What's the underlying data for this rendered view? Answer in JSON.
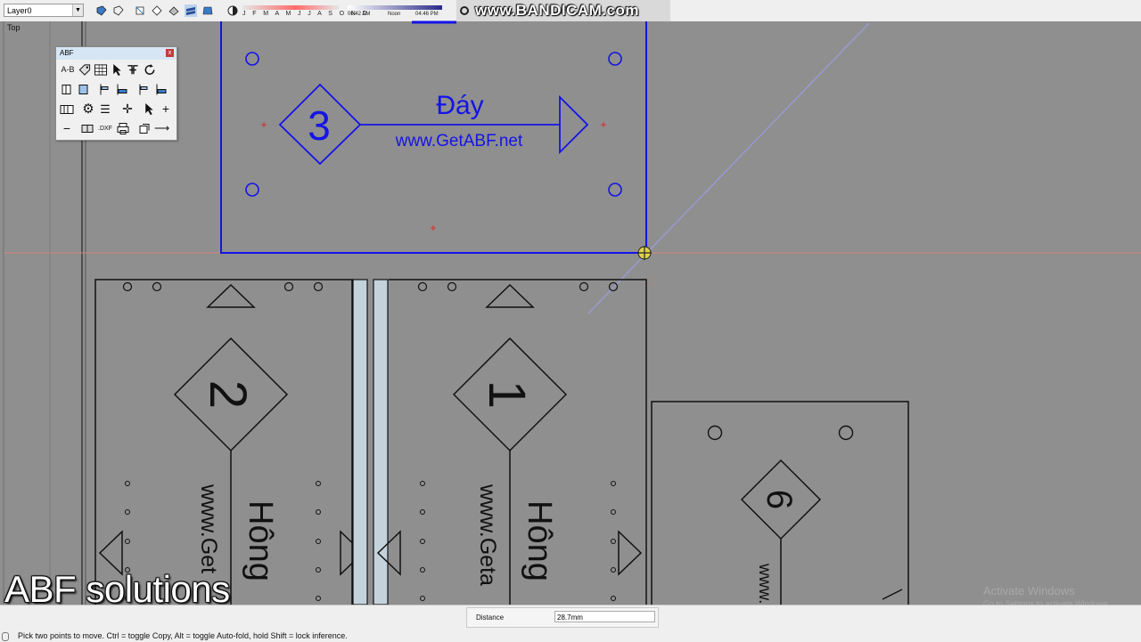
{
  "toolbar": {
    "layer_value": "Layer0",
    "month_labels": "J F M A M J J A S O N D",
    "time_start": "06:42 AM",
    "time_noon": "Noon",
    "time_end": "04:46 PM",
    "tools": [
      "shape-a-icon",
      "shape-b-icon",
      "rect-icon",
      "poly-icon",
      "prism-icon",
      "layers-a-icon",
      "layers-b-icon",
      "shadow-icon",
      "gear-tool-icon"
    ]
  },
  "view": {
    "label": "Top"
  },
  "bandicam_watermark": "www.BANDICAM.com",
  "abf_panel": {
    "title": "ABF",
    "close": "x",
    "row1": [
      "A-B",
      "tag-icon",
      "table-icon",
      "cursor-icon",
      "swap-icon",
      "refresh-icon"
    ],
    "row4_dxf": ".DXF"
  },
  "drawing": {
    "top_panel": {
      "number": "3",
      "label": "Đáy",
      "url": "www.GetABF.net",
      "color": "#1414e6"
    },
    "left_panel": {
      "number": "2",
      "label": "Hông",
      "url": "www.Get"
    },
    "middle_panel": {
      "number": "1",
      "label": "Hông",
      "url": "www.Geta"
    },
    "right_panel": {
      "number": "6",
      "url": "www."
    }
  },
  "watermark": "ABF solutions",
  "activate_windows": {
    "title": "Activate Windows",
    "subtitle": "Go to Settings to activate Windows."
  },
  "status": {
    "vcb_label": "Distance",
    "vcb_value": "28.7mm",
    "hint": "Pick two points to move.  Ctrl = toggle Copy, Alt = toggle Auto-fold, hold Shift = lock inference."
  }
}
